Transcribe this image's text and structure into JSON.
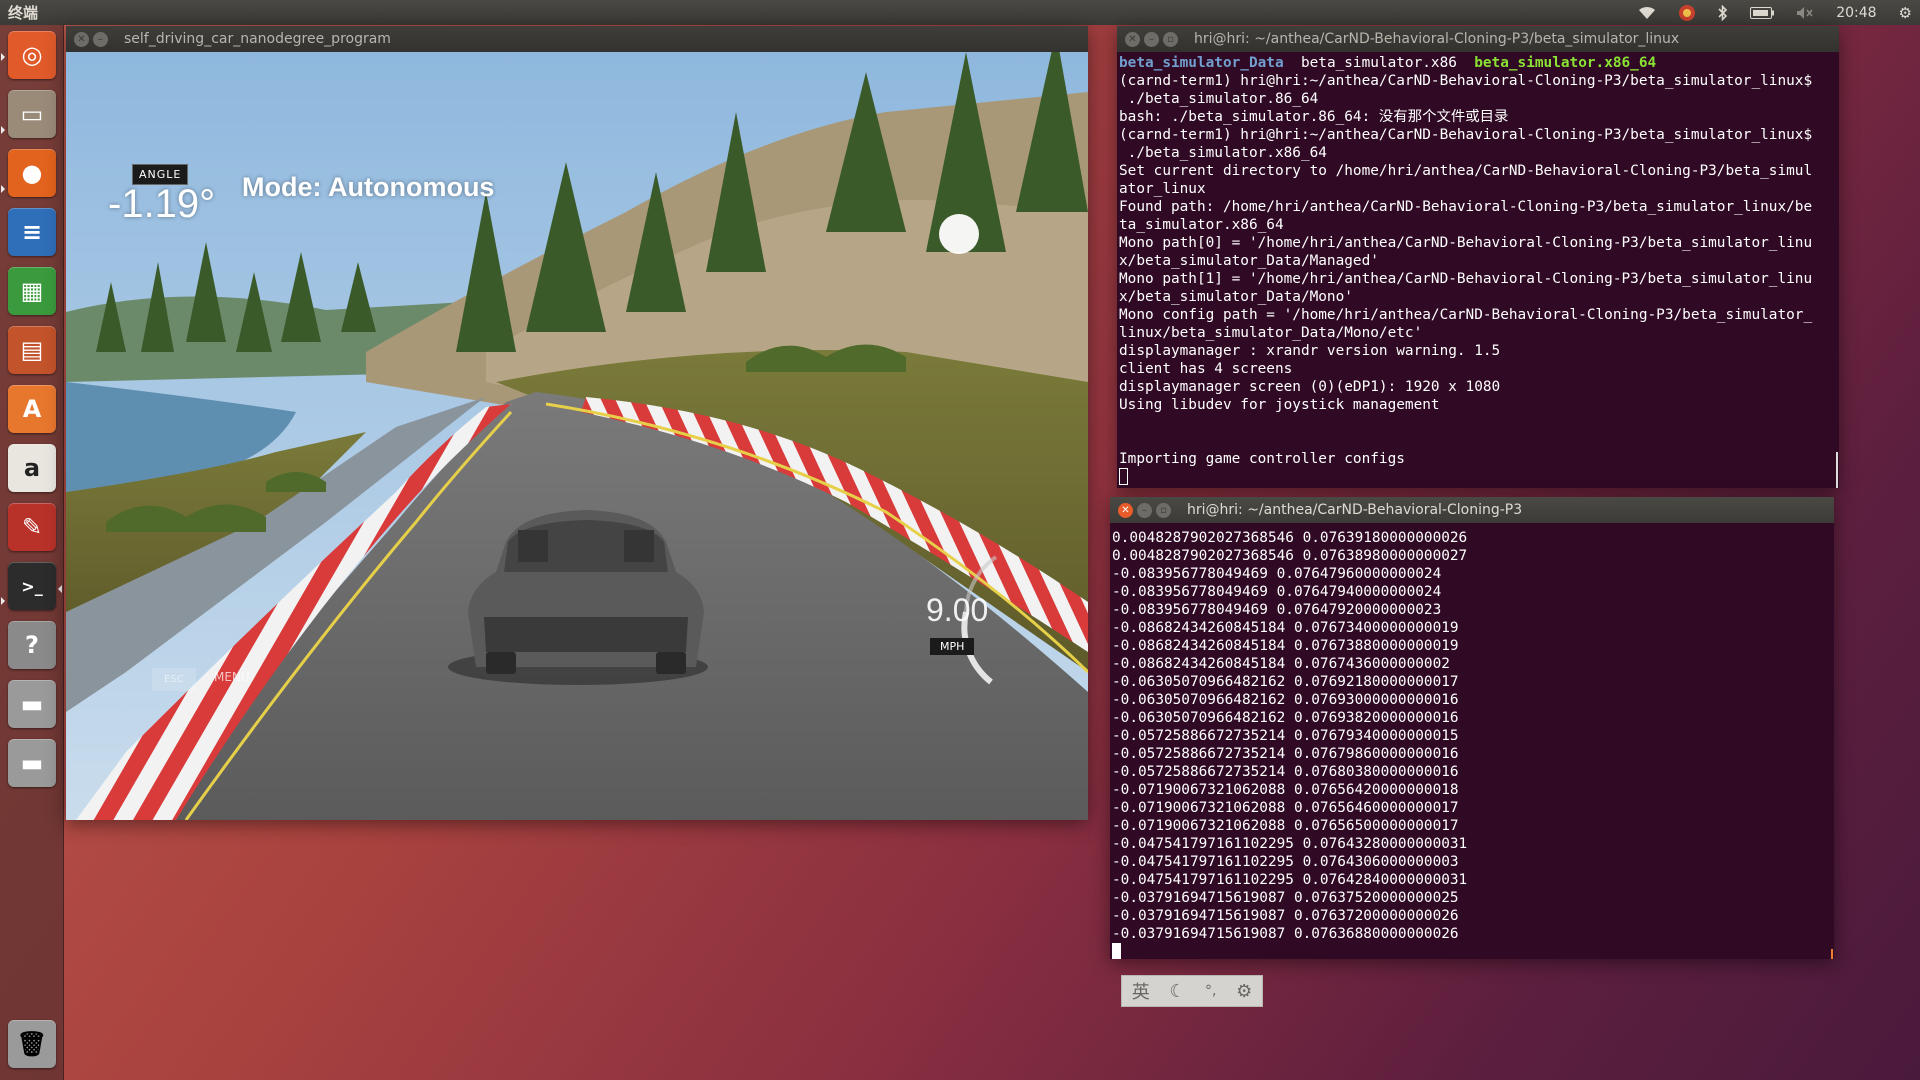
{
  "top_panel": {
    "title": "终端",
    "time": "20:48",
    "icons": [
      "wifi-icon",
      "indicator-app-icon",
      "bluetooth-icon",
      "battery-icon",
      "volume-icon",
      "gear-icon"
    ]
  },
  "launcher": {
    "items": [
      {
        "name": "dash-icon",
        "glyph": "◎",
        "bg": "#e05a2a"
      },
      {
        "name": "files-icon",
        "glyph": "▭",
        "bg": "#9a8a78"
      },
      {
        "name": "firefox-icon",
        "glyph": "●",
        "bg": "#e2631d"
      },
      {
        "name": "writer-icon",
        "glyph": "≡",
        "bg": "#2f6eb8"
      },
      {
        "name": "calc-icon",
        "glyph": "▦",
        "bg": "#3a9a3d"
      },
      {
        "name": "impress-icon",
        "glyph": "▤",
        "bg": "#c2532a"
      },
      {
        "name": "software-center-icon",
        "glyph": "A",
        "bg": "#e8772e"
      },
      {
        "name": "amazon-icon",
        "glyph": "a",
        "bg": "#e9e6e0"
      },
      {
        "name": "system-settings-icon",
        "glyph": "✎",
        "bg": "#b8322a"
      },
      {
        "name": "terminal-icon",
        "glyph": ">_",
        "bg": "#2c2c2c"
      },
      {
        "name": "help-icon",
        "glyph": "?",
        "bg": "#8a8a8a"
      },
      {
        "name": "drive-icon",
        "glyph": "▬",
        "bg": "#9a9a9a"
      },
      {
        "name": "drive-2-icon",
        "glyph": "▬",
        "bg": "#9a9a9a"
      }
    ],
    "trash": {
      "name": "trash-icon",
      "glyph": "🗑",
      "bg": "#9a9a9a"
    }
  },
  "simulator": {
    "title": "self_driving_car_nanodegree_program",
    "angle_tag": "ANGLE",
    "angle_value": "-1.19°",
    "mode": "Mode: Autonomous",
    "speed": "9.00",
    "speed_unit": "MPH",
    "esc_label": "ESC",
    "menu_label": "MENU"
  },
  "terminal1": {
    "title": "hri@hri: ~/anthea/CarND-Behavioral-Cloning-P3/beta_simulator_linux",
    "ls": [
      {
        "text": "beta_simulator_Data",
        "kind": "dir"
      },
      {
        "text": "beta_simulator.x86",
        "kind": "plain"
      },
      {
        "text": "beta_simulator.x86_64",
        "kind": "exec"
      }
    ],
    "lines": [
      "(carnd-term1) hri@hri:~/anthea/CarND-Behavioral-Cloning-P3/beta_simulator_linux$",
      " ./beta_simulator.86_64",
      "bash: ./beta_simulator.86_64: 没有那个文件或目录",
      "(carnd-term1) hri@hri:~/anthea/CarND-Behavioral-Cloning-P3/beta_simulator_linux$",
      " ./beta_simulator.x86_64",
      "Set current directory to /home/hri/anthea/CarND-Behavioral-Cloning-P3/beta_simul",
      "ator_linux",
      "Found path: /home/hri/anthea/CarND-Behavioral-Cloning-P3/beta_simulator_linux/be",
      "ta_simulator.x86_64",
      "Mono path[0] = '/home/hri/anthea/CarND-Behavioral-Cloning-P3/beta_simulator_linu",
      "x/beta_simulator_Data/Managed'",
      "Mono path[1] = '/home/hri/anthea/CarND-Behavioral-Cloning-P3/beta_simulator_linu",
      "x/beta_simulator_Data/Mono'",
      "Mono config path = '/home/hri/anthea/CarND-Behavioral-Cloning-P3/beta_simulator_",
      "linux/beta_simulator_Data/Mono/etc'",
      "displaymanager : xrandr version warning. 1.5",
      "client has 4 screens",
      "displaymanager screen (0)(eDP1): 1920 x 1080",
      "Using libudev for joystick management",
      "",
      "",
      "Importing game controller configs"
    ]
  },
  "terminal2": {
    "title": "hri@hri: ~/anthea/CarND-Behavioral-Cloning-P3",
    "lines": [
      "0.0048287902027368546 0.07639180000000026",
      "0.0048287902027368546 0.07638980000000027",
      "-0.083956778049469 0.07647960000000024",
      "-0.083956778049469 0.07647940000000024",
      "-0.083956778049469 0.07647920000000023",
      "-0.08682434260845184 0.07673400000000019",
      "-0.08682434260845184 0.07673880000000019",
      "-0.08682434260845184 0.0767436000000002",
      "-0.06305070966482162 0.07692180000000017",
      "-0.06305070966482162 0.07693000000000016",
      "-0.06305070966482162 0.07693820000000016",
      "-0.05725886672735214 0.07679340000000015",
      "-0.05725886672735214 0.07679860000000016",
      "-0.05725886672735214 0.07680380000000016",
      "-0.07190067321062088 0.07656420000000018",
      "-0.07190067321062088 0.07656460000000017",
      "-0.07190067321062088 0.07656500000000017",
      "-0.047541797161102295 0.07643280000000031",
      "-0.047541797161102295 0.0764306000000003",
      "-0.047541797161102295 0.07642840000000031",
      "-0.03791694715619087 0.07637520000000025",
      "-0.03791694715619087 0.07637200000000026",
      "-0.03791694715619087 0.07636880000000026"
    ]
  },
  "ime": {
    "lang": "英",
    "items": [
      "moon-icon",
      "punctuation-icon",
      "settings-icon"
    ],
    "glyphs": [
      "☾",
      "°,",
      "⚙"
    ]
  }
}
